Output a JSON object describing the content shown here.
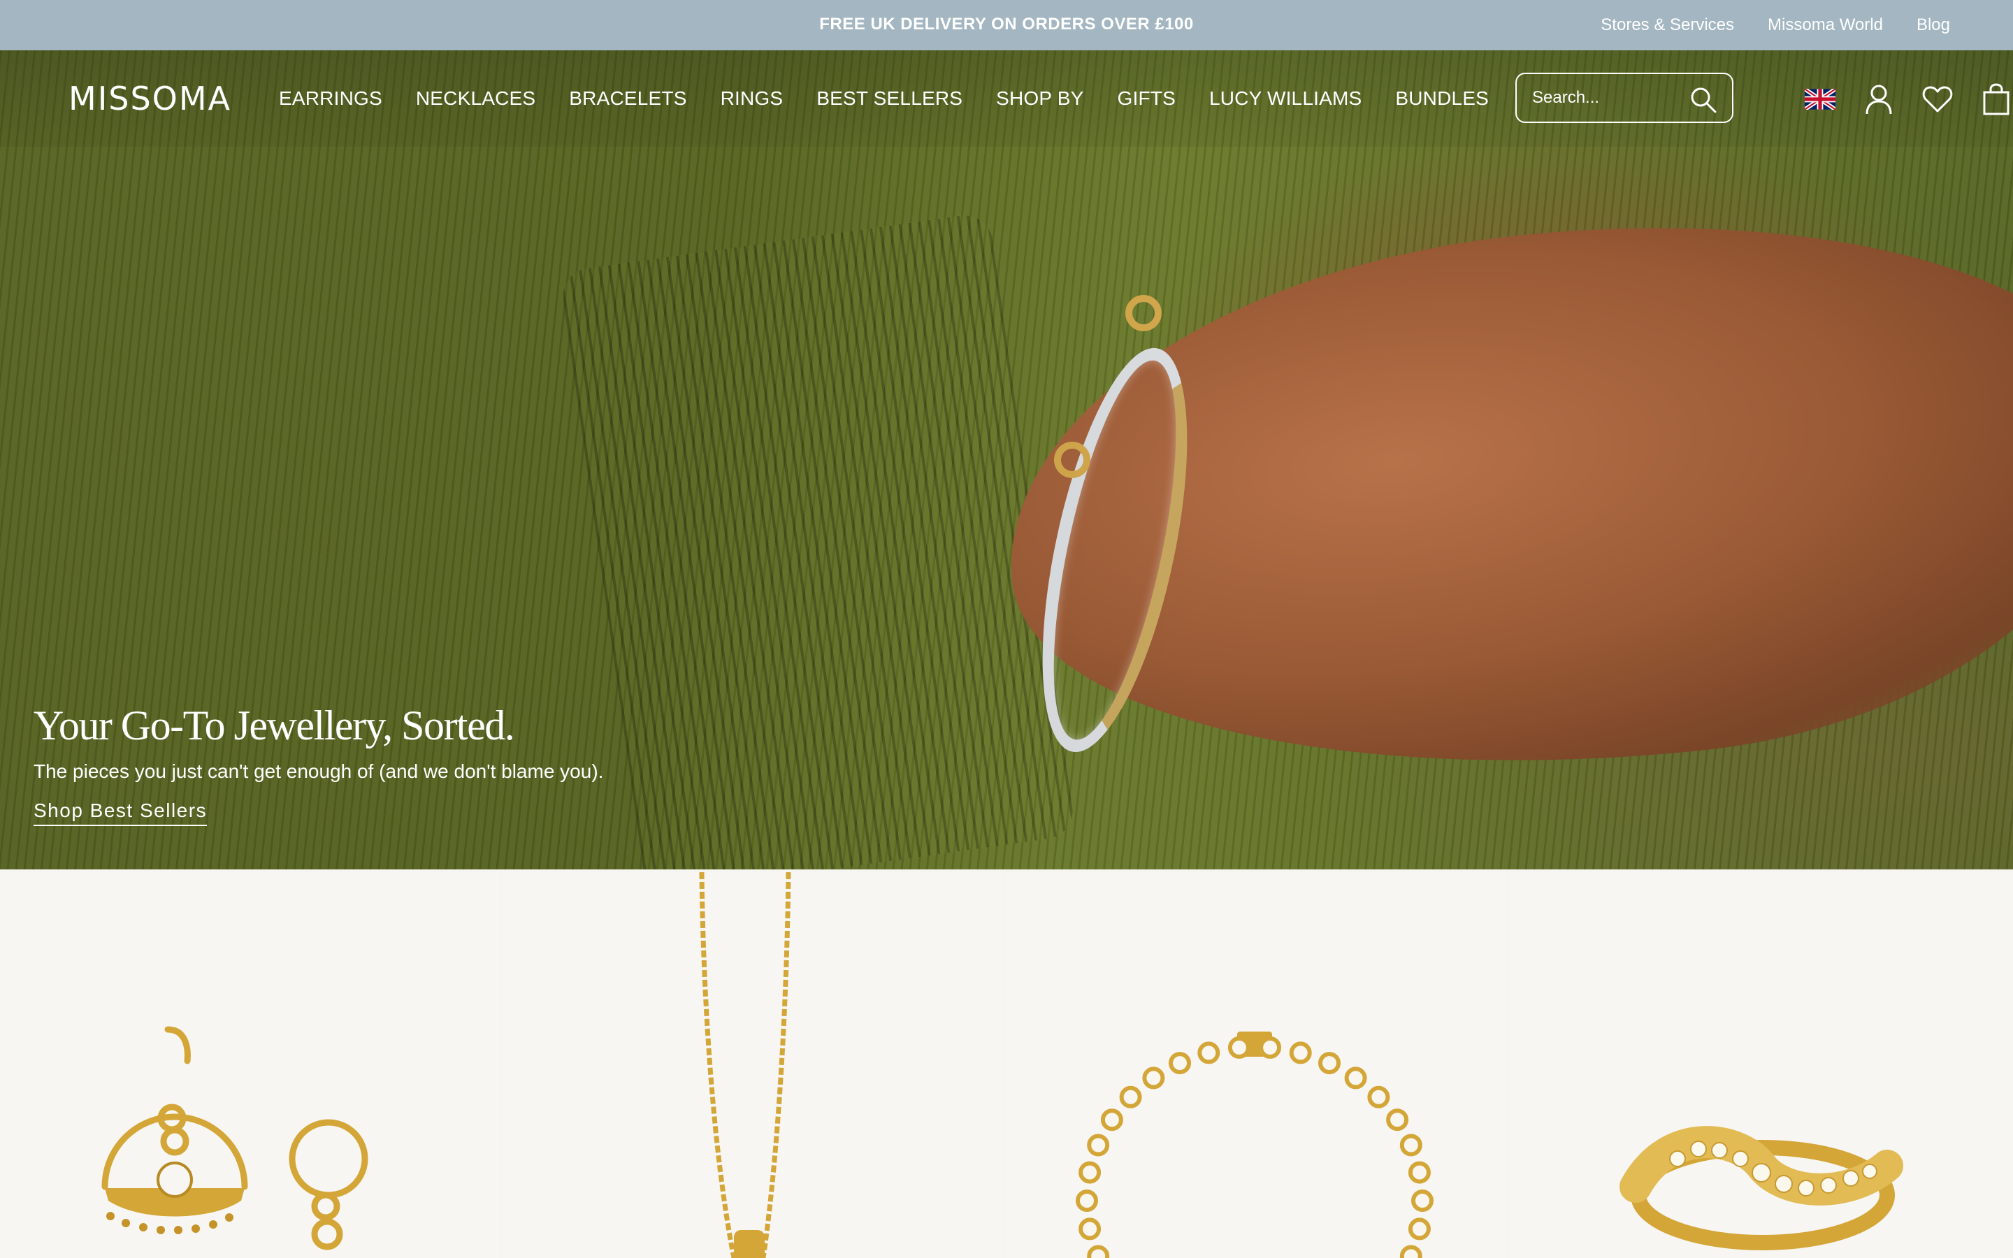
{
  "announcement": {
    "message": "FREE UK DELIVERY ON ORDERS OVER £100",
    "links": [
      "Stores & Services",
      "Missoma World",
      "Blog"
    ]
  },
  "header": {
    "logo": "MISSOMA",
    "menu": [
      "EARRINGS",
      "NECKLACES",
      "BRACELETS",
      "RINGS",
      "BEST SELLERS",
      "SHOP BY",
      "GIFTS",
      "LUCY WILLIAMS",
      "BUNDLES"
    ],
    "search": {
      "placeholder": "Search..."
    },
    "icons": [
      "uk-flag-icon",
      "account-icon",
      "wishlist-heart-icon",
      "shopping-bag-icon"
    ]
  },
  "hero": {
    "title": "Your Go-To Jewellery, Sorted.",
    "subtitle": "The pieces you just can't get enough of (and we don't blame you).",
    "cta": "Shop Best Sellers"
  },
  "products": [
    {
      "kind": "earrings"
    },
    {
      "kind": "necklace"
    },
    {
      "kind": "tennis-bracelet"
    },
    {
      "kind": "ring"
    }
  ],
  "colors": {
    "announcement_bg": "#a3b6c1",
    "gold": "#d4a637",
    "tile_bg": "#f7f6f3"
  }
}
